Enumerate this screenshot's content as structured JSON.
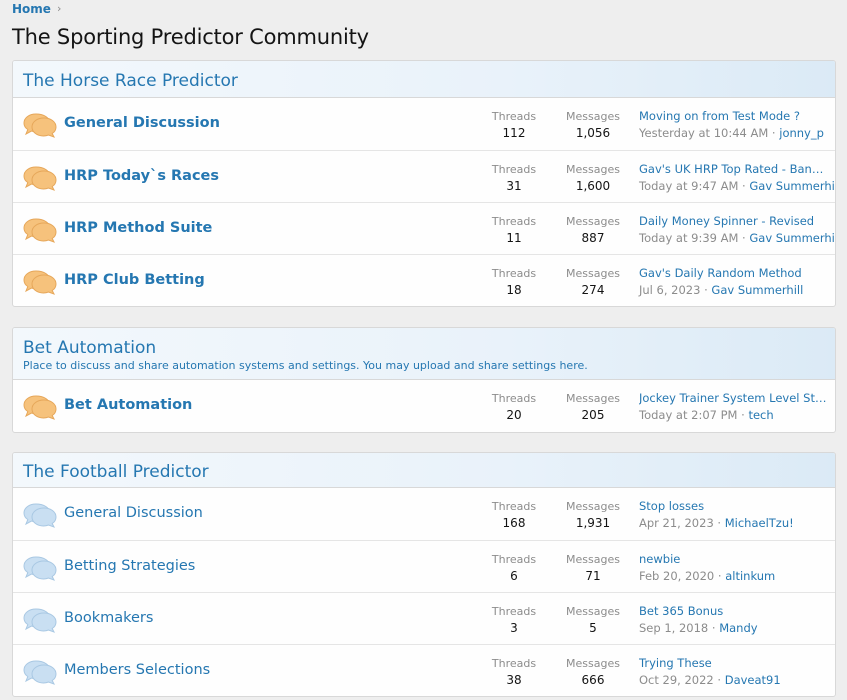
{
  "breadcrumb": {
    "home": "Home",
    "separator": "›"
  },
  "page_title": "The Sporting Predictor Community",
  "labels": {
    "threads": "Threads",
    "messages": "Messages"
  },
  "colors": {
    "accent": "#2577b1",
    "unread_icon": "#f6c27c",
    "read_icon": "#c9dff2"
  },
  "categories": [
    {
      "title": "The Horse Race Predictor",
      "description": "",
      "nodes": [
        {
          "title": "General Discussion",
          "unread": true,
          "threads": "112",
          "messages": "1,056",
          "last_title": "Moving on from Test Mode ?",
          "last_date": "Yesterday at 10:44 AM",
          "last_user": "jonny_p"
        },
        {
          "title": "HRP Today`s Races",
          "unread": true,
          "threads": "31",
          "messages": "1,600",
          "last_title": "Gav's UK HRP Top Rated - Bank B...",
          "last_date": "Today at 9:47 AM",
          "last_user": "Gav Summerhill"
        },
        {
          "title": "HRP Method Suite",
          "unread": true,
          "threads": "11",
          "messages": "887",
          "last_title": "Daily Money Spinner - Revised",
          "last_date": "Today at 9:39 AM",
          "last_user": "Gav Summerhill"
        },
        {
          "title": "HRP Club Betting",
          "unread": true,
          "threads": "18",
          "messages": "274",
          "last_title": "Gav's Daily Random Method",
          "last_date": "Jul 6, 2023",
          "last_user": "Gav Summerhill"
        }
      ]
    },
    {
      "title": "Bet Automation",
      "description": "Place to discuss and share automation systems and settings. You may upload and share settings here.",
      "nodes": [
        {
          "title": "Bet Automation",
          "unread": true,
          "threads": "20",
          "messages": "205",
          "last_title": "Jockey Trainer System Level Stake...",
          "last_date": "Today at 2:07 PM",
          "last_user": "tech"
        }
      ]
    },
    {
      "title": "The Football Predictor",
      "description": "",
      "nodes": [
        {
          "title": "General Discussion",
          "unread": false,
          "threads": "168",
          "messages": "1,931",
          "last_title": "Stop losses",
          "last_date": "Apr 21, 2023",
          "last_user": "MichaelTzu!"
        },
        {
          "title": "Betting Strategies",
          "unread": false,
          "threads": "6",
          "messages": "71",
          "last_title": "newbie",
          "last_date": "Feb 20, 2020",
          "last_user": "altinkum"
        },
        {
          "title": "Bookmakers",
          "unread": false,
          "threads": "3",
          "messages": "5",
          "last_title": "Bet 365 Bonus",
          "last_date": "Sep 1, 2018",
          "last_user": "Mandy"
        },
        {
          "title": "Members Selections",
          "unread": false,
          "threads": "38",
          "messages": "666",
          "last_title": "Trying These",
          "last_date": "Oct 29, 2022",
          "last_user": "Daveat91"
        }
      ]
    }
  ]
}
